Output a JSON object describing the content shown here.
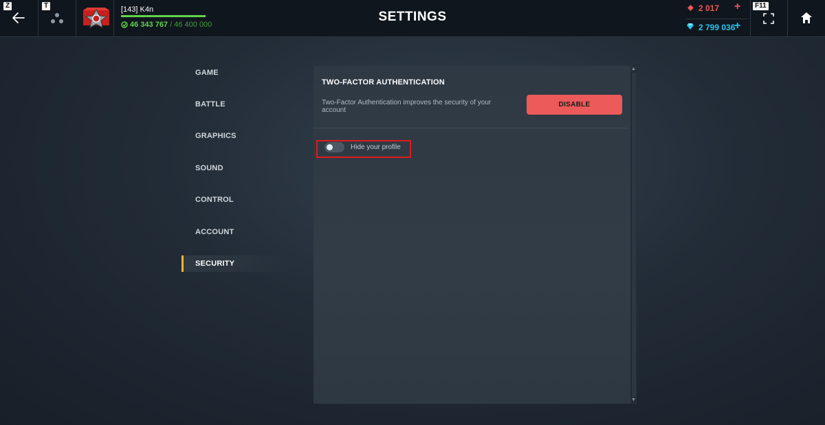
{
  "topbar": {
    "back_key": "Z",
    "social_key": "T",
    "fullscreen_key": "F11",
    "title": "SETTINGS"
  },
  "player": {
    "name": "[143] K4n",
    "xp_current": "46 343 767",
    "xp_max": "/ 46 400 000",
    "xp_progress": 0.9988
  },
  "currency": {
    "rubies": "2 017",
    "crystals": "2 799 036",
    "plus": "+"
  },
  "nav": {
    "items": [
      "GAME",
      "BATTLE",
      "GRAPHICS",
      "SOUND",
      "CONTROL",
      "ACCOUNT",
      "SECURITY"
    ],
    "active": "SECURITY"
  },
  "security": {
    "section_title": "TWO-FACTOR AUTHENTICATION",
    "description": "Two-Factor Authentication improves the security of your account",
    "disable_label": "DISABLE",
    "hide_profile_label": "Hide your profile",
    "hide_profile_on": false
  },
  "colors": {
    "accent_active": "#f5b529",
    "ruby": "#ec5757",
    "crystal": "#26c3f0",
    "xp": "#62d44a",
    "disable_button": "#ec5a5a",
    "highlight_box": "#e01b1b"
  },
  "icons": {
    "back": "arrow-left-icon",
    "social": "three-dots-icon",
    "fullscreen": "fullscreen-icon",
    "home": "home-icon",
    "rank": "rank-badge-icon",
    "xp": "xp-icon",
    "ruby": "ruby-icon",
    "crystal": "crystal-icon"
  }
}
